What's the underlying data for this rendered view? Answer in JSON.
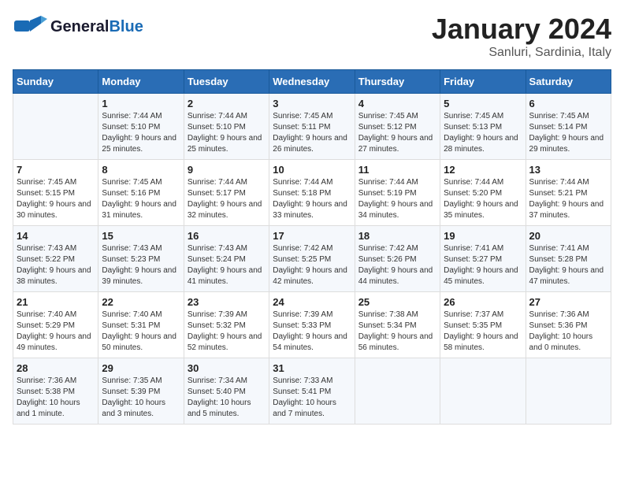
{
  "header": {
    "logo_general": "General",
    "logo_blue": "Blue",
    "month": "January 2024",
    "location": "Sanluri, Sardinia, Italy"
  },
  "weekdays": [
    "Sunday",
    "Monday",
    "Tuesday",
    "Wednesday",
    "Thursday",
    "Friday",
    "Saturday"
  ],
  "weeks": [
    [
      {
        "day": "",
        "sunrise": "",
        "sunset": "",
        "daylight": ""
      },
      {
        "day": "1",
        "sunrise": "Sunrise: 7:44 AM",
        "sunset": "Sunset: 5:10 PM",
        "daylight": "Daylight: 9 hours and 25 minutes."
      },
      {
        "day": "2",
        "sunrise": "Sunrise: 7:44 AM",
        "sunset": "Sunset: 5:10 PM",
        "daylight": "Daylight: 9 hours and 25 minutes."
      },
      {
        "day": "3",
        "sunrise": "Sunrise: 7:45 AM",
        "sunset": "Sunset: 5:11 PM",
        "daylight": "Daylight: 9 hours and 26 minutes."
      },
      {
        "day": "4",
        "sunrise": "Sunrise: 7:45 AM",
        "sunset": "Sunset: 5:12 PM",
        "daylight": "Daylight: 9 hours and 27 minutes."
      },
      {
        "day": "5",
        "sunrise": "Sunrise: 7:45 AM",
        "sunset": "Sunset: 5:13 PM",
        "daylight": "Daylight: 9 hours and 28 minutes."
      },
      {
        "day": "6",
        "sunrise": "Sunrise: 7:45 AM",
        "sunset": "Sunset: 5:14 PM",
        "daylight": "Daylight: 9 hours and 29 minutes."
      }
    ],
    [
      {
        "day": "7",
        "sunrise": "Sunrise: 7:45 AM",
        "sunset": "Sunset: 5:15 PM",
        "daylight": "Daylight: 9 hours and 30 minutes."
      },
      {
        "day": "8",
        "sunrise": "Sunrise: 7:45 AM",
        "sunset": "Sunset: 5:16 PM",
        "daylight": "Daylight: 9 hours and 31 minutes."
      },
      {
        "day": "9",
        "sunrise": "Sunrise: 7:44 AM",
        "sunset": "Sunset: 5:17 PM",
        "daylight": "Daylight: 9 hours and 32 minutes."
      },
      {
        "day": "10",
        "sunrise": "Sunrise: 7:44 AM",
        "sunset": "Sunset: 5:18 PM",
        "daylight": "Daylight: 9 hours and 33 minutes."
      },
      {
        "day": "11",
        "sunrise": "Sunrise: 7:44 AM",
        "sunset": "Sunset: 5:19 PM",
        "daylight": "Daylight: 9 hours and 34 minutes."
      },
      {
        "day": "12",
        "sunrise": "Sunrise: 7:44 AM",
        "sunset": "Sunset: 5:20 PM",
        "daylight": "Daylight: 9 hours and 35 minutes."
      },
      {
        "day": "13",
        "sunrise": "Sunrise: 7:44 AM",
        "sunset": "Sunset: 5:21 PM",
        "daylight": "Daylight: 9 hours and 37 minutes."
      }
    ],
    [
      {
        "day": "14",
        "sunrise": "Sunrise: 7:43 AM",
        "sunset": "Sunset: 5:22 PM",
        "daylight": "Daylight: 9 hours and 38 minutes."
      },
      {
        "day": "15",
        "sunrise": "Sunrise: 7:43 AM",
        "sunset": "Sunset: 5:23 PM",
        "daylight": "Daylight: 9 hours and 39 minutes."
      },
      {
        "day": "16",
        "sunrise": "Sunrise: 7:43 AM",
        "sunset": "Sunset: 5:24 PM",
        "daylight": "Daylight: 9 hours and 41 minutes."
      },
      {
        "day": "17",
        "sunrise": "Sunrise: 7:42 AM",
        "sunset": "Sunset: 5:25 PM",
        "daylight": "Daylight: 9 hours and 42 minutes."
      },
      {
        "day": "18",
        "sunrise": "Sunrise: 7:42 AM",
        "sunset": "Sunset: 5:26 PM",
        "daylight": "Daylight: 9 hours and 44 minutes."
      },
      {
        "day": "19",
        "sunrise": "Sunrise: 7:41 AM",
        "sunset": "Sunset: 5:27 PM",
        "daylight": "Daylight: 9 hours and 45 minutes."
      },
      {
        "day": "20",
        "sunrise": "Sunrise: 7:41 AM",
        "sunset": "Sunset: 5:28 PM",
        "daylight": "Daylight: 9 hours and 47 minutes."
      }
    ],
    [
      {
        "day": "21",
        "sunrise": "Sunrise: 7:40 AM",
        "sunset": "Sunset: 5:29 PM",
        "daylight": "Daylight: 9 hours and 49 minutes."
      },
      {
        "day": "22",
        "sunrise": "Sunrise: 7:40 AM",
        "sunset": "Sunset: 5:31 PM",
        "daylight": "Daylight: 9 hours and 50 minutes."
      },
      {
        "day": "23",
        "sunrise": "Sunrise: 7:39 AM",
        "sunset": "Sunset: 5:32 PM",
        "daylight": "Daylight: 9 hours and 52 minutes."
      },
      {
        "day": "24",
        "sunrise": "Sunrise: 7:39 AM",
        "sunset": "Sunset: 5:33 PM",
        "daylight": "Daylight: 9 hours and 54 minutes."
      },
      {
        "day": "25",
        "sunrise": "Sunrise: 7:38 AM",
        "sunset": "Sunset: 5:34 PM",
        "daylight": "Daylight: 9 hours and 56 minutes."
      },
      {
        "day": "26",
        "sunrise": "Sunrise: 7:37 AM",
        "sunset": "Sunset: 5:35 PM",
        "daylight": "Daylight: 9 hours and 58 minutes."
      },
      {
        "day": "27",
        "sunrise": "Sunrise: 7:36 AM",
        "sunset": "Sunset: 5:36 PM",
        "daylight": "Daylight: 10 hours and 0 minutes."
      }
    ],
    [
      {
        "day": "28",
        "sunrise": "Sunrise: 7:36 AM",
        "sunset": "Sunset: 5:38 PM",
        "daylight": "Daylight: 10 hours and 1 minute."
      },
      {
        "day": "29",
        "sunrise": "Sunrise: 7:35 AM",
        "sunset": "Sunset: 5:39 PM",
        "daylight": "Daylight: 10 hours and 3 minutes."
      },
      {
        "day": "30",
        "sunrise": "Sunrise: 7:34 AM",
        "sunset": "Sunset: 5:40 PM",
        "daylight": "Daylight: 10 hours and 5 minutes."
      },
      {
        "day": "31",
        "sunrise": "Sunrise: 7:33 AM",
        "sunset": "Sunset: 5:41 PM",
        "daylight": "Daylight: 10 hours and 7 minutes."
      },
      {
        "day": "",
        "sunrise": "",
        "sunset": "",
        "daylight": ""
      },
      {
        "day": "",
        "sunrise": "",
        "sunset": "",
        "daylight": ""
      },
      {
        "day": "",
        "sunrise": "",
        "sunset": "",
        "daylight": ""
      }
    ]
  ]
}
